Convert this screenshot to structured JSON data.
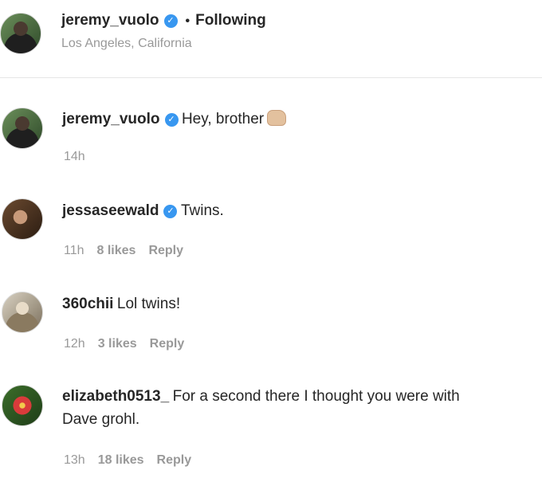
{
  "post_header": {
    "username": "jeremy_vuolo",
    "verified_icon": "verified-check-icon",
    "separator": "•",
    "follow_status": "Following",
    "location": "Los Angeles, California"
  },
  "comments": [
    {
      "username": "jeremy_vuolo",
      "verified": true,
      "text": "Hey, brother",
      "emoji": "fist-bump-emoji",
      "time": "14h",
      "likes": "",
      "reply": ""
    },
    {
      "username": "jessaseewald",
      "verified": true,
      "text": "Twins.",
      "time": "11h",
      "likes": "8 likes",
      "reply": "Reply"
    },
    {
      "username": "360chii",
      "verified": false,
      "text": "Lol twins!",
      "time": "12h",
      "likes": "3 likes",
      "reply": "Reply"
    },
    {
      "username": "elizabeth0513_",
      "verified": false,
      "text": "For a second there I thought you were with",
      "text_line2": "Dave grohl.",
      "time": "13h",
      "likes": "18 likes",
      "reply": "Reply"
    }
  ],
  "colors": {
    "verified": "#3897f0",
    "text": "#262626",
    "muted": "#999999",
    "divider": "#e6e6e6"
  }
}
